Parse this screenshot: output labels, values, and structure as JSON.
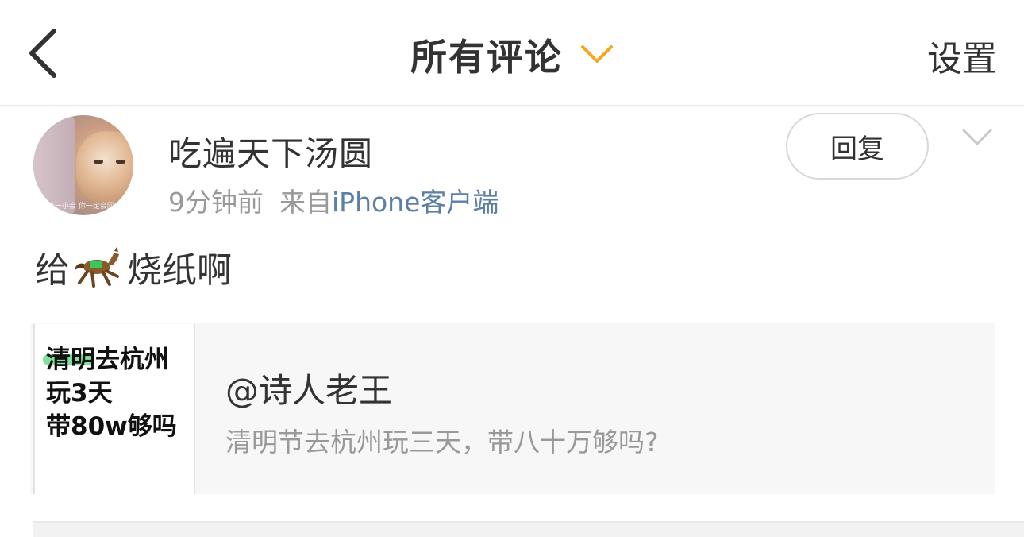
{
  "navbar": {
    "back_icon": "chevron-left-icon",
    "title": "所有评论",
    "title_dropdown_icon": "chevron-down-icon",
    "settings_label": "设置",
    "accent_color": "#f5a623"
  },
  "comment": {
    "username": "吃遍天下汤圆",
    "time": "9分钟前",
    "source_prefix": "来自",
    "source_client": "iPhone客户端",
    "reply_label": "回复",
    "more_icon": "chevron-down-icon",
    "avatar_caption": "等一小会 你一定会回",
    "text_before": "给",
    "emoji": "horse-emoji",
    "text_after": "烧纸啊",
    "link_color": "#5b7fa6"
  },
  "quote": {
    "thumb_lines": [
      "清明去杭州",
      "玩3天",
      "带80w够吗"
    ],
    "author": "@诗人老王",
    "description": "清明节去杭州玩三天，带八十万够吗?"
  }
}
